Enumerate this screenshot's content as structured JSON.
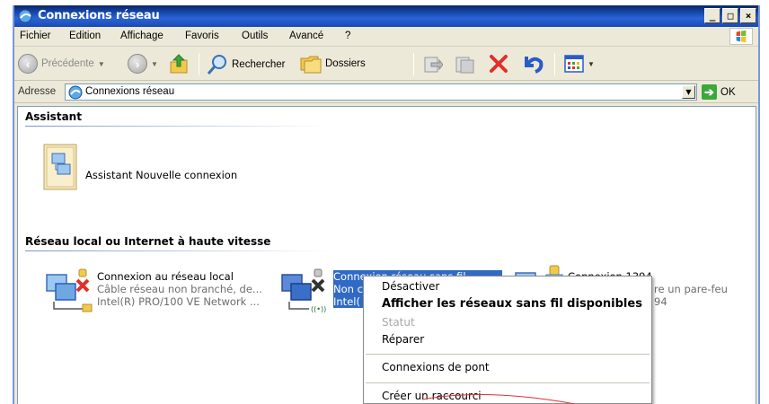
{
  "window": {
    "title": "Connexions réseau",
    "buttons": [
      "_",
      "□",
      "×"
    ]
  },
  "menu": [
    "Fichier",
    "Edition",
    "Affichage",
    "Favoris",
    "Outils",
    "Avancé",
    "?"
  ],
  "toolbar": {
    "back_label": "Précédente",
    "search_label": "Rechercher",
    "folders_label": "Dossiers"
  },
  "address": {
    "label": "Adresse",
    "value": "Connexions réseau",
    "go_label": "OK"
  },
  "groups": {
    "assistant": {
      "header": "Assistant",
      "item": {
        "label": "Assistant Nouvelle connexion",
        "icon": "wizard-icon"
      }
    },
    "lan": {
      "header": "Réseau local ou Internet à haute vitesse",
      "items": [
        {
          "name": "Connexion au réseau local",
          "status": "Câble réseau non branché, de...",
          "device": "Intel(R) PRO/100 VE Network ...",
          "icon": "lan-connection-icon"
        },
        {
          "name": "Connexion réseau sans fil",
          "status": "Non c",
          "device": "Intel(",
          "icon": "wireless-connection-icon"
        },
        {
          "name": "Connexion 1394",
          "status": "re un pare-feu",
          "device": "94",
          "icon": "firewire-connection-icon"
        }
      ]
    }
  },
  "context_menu": {
    "items": [
      {
        "label": "Désactiver",
        "style": "normal"
      },
      {
        "label": "Afficher les réseaux sans fil disponibles",
        "style": "bold"
      },
      {
        "label": "Statut",
        "style": "disabled"
      },
      {
        "label": "Réparer",
        "style": "normal"
      },
      {
        "label": "Connexions de pont",
        "style": "normal"
      },
      {
        "label": "Créer un raccourci",
        "style": "normal"
      }
    ]
  },
  "colors": {
    "titlebar": "#2b64d6",
    "selection": "#316ac5",
    "annotation": "#e03030"
  }
}
